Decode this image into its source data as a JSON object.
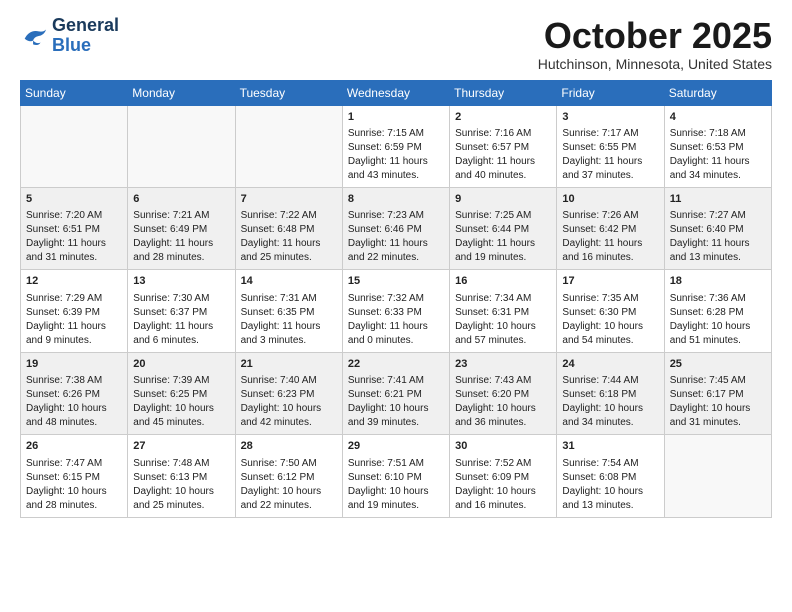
{
  "logo": {
    "line1": "General",
    "line2": "Blue"
  },
  "title": "October 2025",
  "location": "Hutchinson, Minnesota, United States",
  "days_header": [
    "Sunday",
    "Monday",
    "Tuesday",
    "Wednesday",
    "Thursday",
    "Friday",
    "Saturday"
  ],
  "weeks": [
    [
      {
        "day": "",
        "info": ""
      },
      {
        "day": "",
        "info": ""
      },
      {
        "day": "",
        "info": ""
      },
      {
        "day": "1",
        "info": "Sunrise: 7:15 AM\nSunset: 6:59 PM\nDaylight: 11 hours\nand 43 minutes."
      },
      {
        "day": "2",
        "info": "Sunrise: 7:16 AM\nSunset: 6:57 PM\nDaylight: 11 hours\nand 40 minutes."
      },
      {
        "day": "3",
        "info": "Sunrise: 7:17 AM\nSunset: 6:55 PM\nDaylight: 11 hours\nand 37 minutes."
      },
      {
        "day": "4",
        "info": "Sunrise: 7:18 AM\nSunset: 6:53 PM\nDaylight: 11 hours\nand 34 minutes."
      }
    ],
    [
      {
        "day": "5",
        "info": "Sunrise: 7:20 AM\nSunset: 6:51 PM\nDaylight: 11 hours\nand 31 minutes."
      },
      {
        "day": "6",
        "info": "Sunrise: 7:21 AM\nSunset: 6:49 PM\nDaylight: 11 hours\nand 28 minutes."
      },
      {
        "day": "7",
        "info": "Sunrise: 7:22 AM\nSunset: 6:48 PM\nDaylight: 11 hours\nand 25 minutes."
      },
      {
        "day": "8",
        "info": "Sunrise: 7:23 AM\nSunset: 6:46 PM\nDaylight: 11 hours\nand 22 minutes."
      },
      {
        "day": "9",
        "info": "Sunrise: 7:25 AM\nSunset: 6:44 PM\nDaylight: 11 hours\nand 19 minutes."
      },
      {
        "day": "10",
        "info": "Sunrise: 7:26 AM\nSunset: 6:42 PM\nDaylight: 11 hours\nand 16 minutes."
      },
      {
        "day": "11",
        "info": "Sunrise: 7:27 AM\nSunset: 6:40 PM\nDaylight: 11 hours\nand 13 minutes."
      }
    ],
    [
      {
        "day": "12",
        "info": "Sunrise: 7:29 AM\nSunset: 6:39 PM\nDaylight: 11 hours\nand 9 minutes."
      },
      {
        "day": "13",
        "info": "Sunrise: 7:30 AM\nSunset: 6:37 PM\nDaylight: 11 hours\nand 6 minutes."
      },
      {
        "day": "14",
        "info": "Sunrise: 7:31 AM\nSunset: 6:35 PM\nDaylight: 11 hours\nand 3 minutes."
      },
      {
        "day": "15",
        "info": "Sunrise: 7:32 AM\nSunset: 6:33 PM\nDaylight: 11 hours\nand 0 minutes."
      },
      {
        "day": "16",
        "info": "Sunrise: 7:34 AM\nSunset: 6:31 PM\nDaylight: 10 hours\nand 57 minutes."
      },
      {
        "day": "17",
        "info": "Sunrise: 7:35 AM\nSunset: 6:30 PM\nDaylight: 10 hours\nand 54 minutes."
      },
      {
        "day": "18",
        "info": "Sunrise: 7:36 AM\nSunset: 6:28 PM\nDaylight: 10 hours\nand 51 minutes."
      }
    ],
    [
      {
        "day": "19",
        "info": "Sunrise: 7:38 AM\nSunset: 6:26 PM\nDaylight: 10 hours\nand 48 minutes."
      },
      {
        "day": "20",
        "info": "Sunrise: 7:39 AM\nSunset: 6:25 PM\nDaylight: 10 hours\nand 45 minutes."
      },
      {
        "day": "21",
        "info": "Sunrise: 7:40 AM\nSunset: 6:23 PM\nDaylight: 10 hours\nand 42 minutes."
      },
      {
        "day": "22",
        "info": "Sunrise: 7:41 AM\nSunset: 6:21 PM\nDaylight: 10 hours\nand 39 minutes."
      },
      {
        "day": "23",
        "info": "Sunrise: 7:43 AM\nSunset: 6:20 PM\nDaylight: 10 hours\nand 36 minutes."
      },
      {
        "day": "24",
        "info": "Sunrise: 7:44 AM\nSunset: 6:18 PM\nDaylight: 10 hours\nand 34 minutes."
      },
      {
        "day": "25",
        "info": "Sunrise: 7:45 AM\nSunset: 6:17 PM\nDaylight: 10 hours\nand 31 minutes."
      }
    ],
    [
      {
        "day": "26",
        "info": "Sunrise: 7:47 AM\nSunset: 6:15 PM\nDaylight: 10 hours\nand 28 minutes."
      },
      {
        "day": "27",
        "info": "Sunrise: 7:48 AM\nSunset: 6:13 PM\nDaylight: 10 hours\nand 25 minutes."
      },
      {
        "day": "28",
        "info": "Sunrise: 7:50 AM\nSunset: 6:12 PM\nDaylight: 10 hours\nand 22 minutes."
      },
      {
        "day": "29",
        "info": "Sunrise: 7:51 AM\nSunset: 6:10 PM\nDaylight: 10 hours\nand 19 minutes."
      },
      {
        "day": "30",
        "info": "Sunrise: 7:52 AM\nSunset: 6:09 PM\nDaylight: 10 hours\nand 16 minutes."
      },
      {
        "day": "31",
        "info": "Sunrise: 7:54 AM\nSunset: 6:08 PM\nDaylight: 10 hours\nand 13 minutes."
      },
      {
        "day": "",
        "info": ""
      }
    ]
  ],
  "shaded_weeks": [
    1,
    3
  ],
  "colors": {
    "header_bg": "#2a6ebb",
    "shaded_bg": "#f0f0f0",
    "border": "#cccccc"
  }
}
